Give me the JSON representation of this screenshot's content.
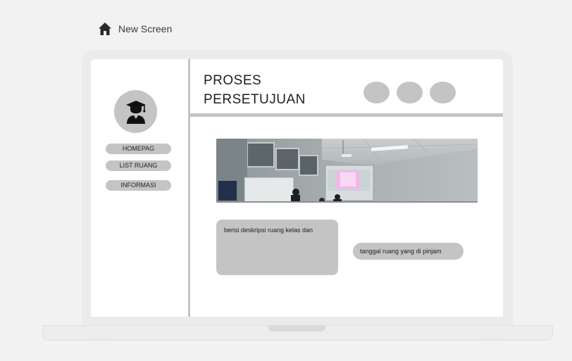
{
  "canvas": {
    "title": "New Screen",
    "home_icon": "home-icon"
  },
  "sidebar": {
    "avatar_icon": "graduate-icon",
    "items": [
      {
        "label": "HOMEPAG"
      },
      {
        "label": "LIST RUANG"
      },
      {
        "label": "INFORMASI"
      }
    ]
  },
  "header": {
    "title_line1": "PROSES",
    "title_line2": "PERSETUJUAN",
    "action_buttons": 3
  },
  "main": {
    "image_subject": "classroom-photo",
    "description": "berisi deskripsi ruang kelas dan",
    "date_label": "tanggal ruang yang di pinjam"
  },
  "colors": {
    "background": "#f2f2f2",
    "laptop_frame": "#ebebeb",
    "screen": "#ffffff",
    "placeholder_gray": "#c4c4c4"
  }
}
